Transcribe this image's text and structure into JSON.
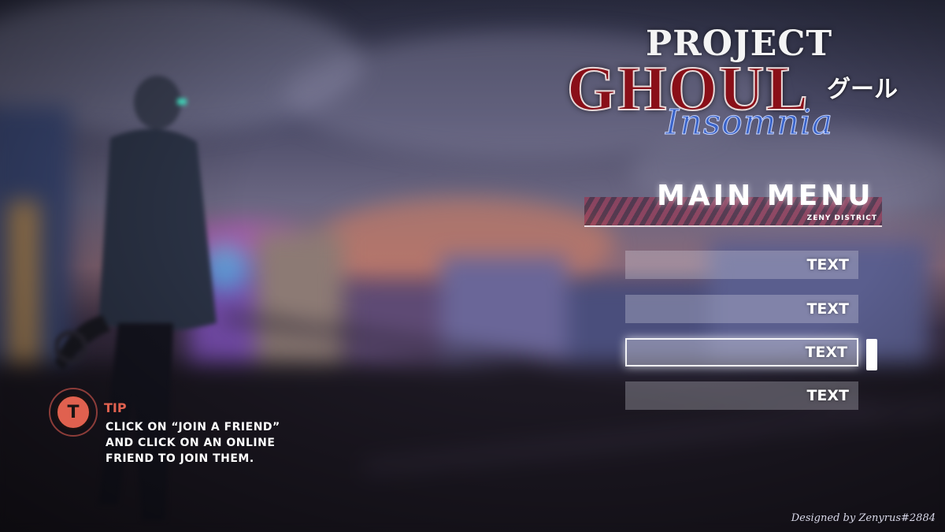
{
  "logo": {
    "line1": "PROJECT",
    "line2": "GHOUL",
    "kana": "グール",
    "line3": "Insomnia"
  },
  "menu": {
    "title": "MAIN MENU",
    "subtitle": "ZENY DISTRICT",
    "items": [
      {
        "label": "TEXT"
      },
      {
        "label": "TEXT"
      },
      {
        "label": "TEXT",
        "selected": true
      },
      {
        "label": "TEXT"
      }
    ]
  },
  "tip": {
    "key": "T",
    "label": "TIP",
    "lines": [
      "CLICK ON “JOIN A FRIEND”",
      "AND CLICK ON AN ONLINE",
      "FRIEND TO JOIN THEM."
    ]
  },
  "credit": "Designed by Zenyrus#2884",
  "colors": {
    "accent_red": "#e0614f",
    "logo_red": "#8a0f18",
    "logo_blue": "#3b64c8"
  }
}
